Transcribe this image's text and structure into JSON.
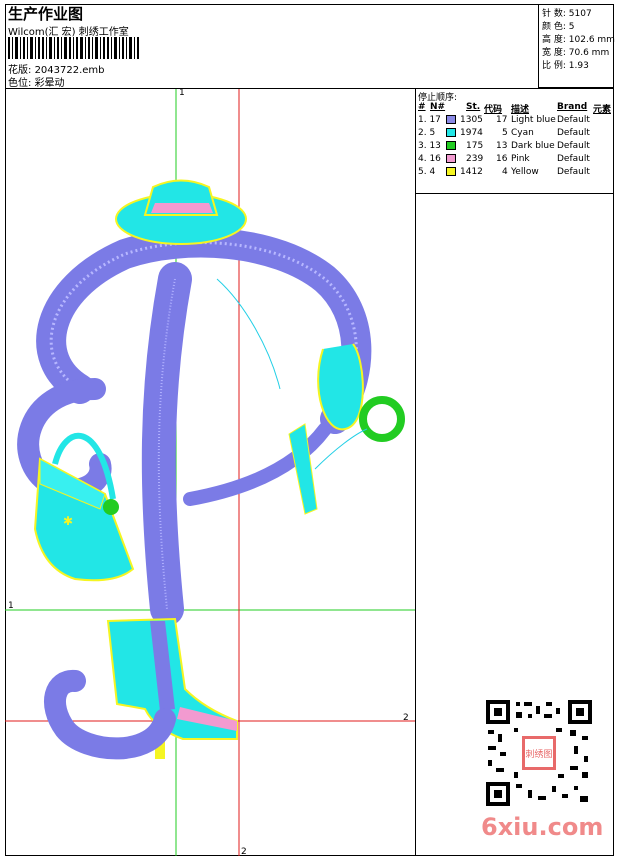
{
  "header": {
    "title": "生产作业图",
    "company": "Wilcom(汇 宏) 刺绣工作室",
    "design_label": "花版:",
    "design_file": "2043722.emb",
    "color_label": "色位:",
    "color_value": "彩晕动"
  },
  "stats": [
    {
      "label": "针 数:",
      "value": "5107"
    },
    {
      "label": "颜 色:",
      "value": "5"
    },
    {
      "label": "高 度:",
      "value": "102.6 mm"
    },
    {
      "label": "宽 度:",
      "value": "70.6 mm"
    },
    {
      "label": "比 例:",
      "value": "1.93"
    }
  ],
  "stop_sequence": {
    "title": "停止顺序:",
    "headers": [
      "#",
      "N#",
      "St.",
      "代码",
      "描述",
      "Brand",
      "元素"
    ],
    "rows": [
      {
        "seq": "1. 17",
        "color": "#8a8ae6",
        "stitches": "1305",
        "code": "17",
        "desc": "Light blue",
        "brand": "Default"
      },
      {
        "seq": "2. 5",
        "color": "#22e6e6",
        "stitches": "1974",
        "code": "5",
        "desc": "Cyan",
        "brand": "Default"
      },
      {
        "seq": "3. 13",
        "color": "#22cc22",
        "stitches": "175",
        "code": "13",
        "desc": "Dark blue",
        "brand": "Default"
      },
      {
        "seq": "4. 16",
        "color": "#f29ad0",
        "stitches": "239",
        "code": "16",
        "desc": "Pink",
        "brand": "Default"
      },
      {
        "seq": "5. 4",
        "color": "#f5f522",
        "stitches": "1412",
        "code": "4",
        "desc": "Yellow",
        "brand": "Default"
      }
    ]
  },
  "axes": {
    "green_v": "1",
    "green_h": "1",
    "red_h": "2",
    "red_v": "2"
  },
  "watermark": "6xiu.com",
  "qr_stamp": "刺绣图",
  "icons": {
    "qr": "qr-code-icon",
    "barcode": "barcode-icon"
  }
}
